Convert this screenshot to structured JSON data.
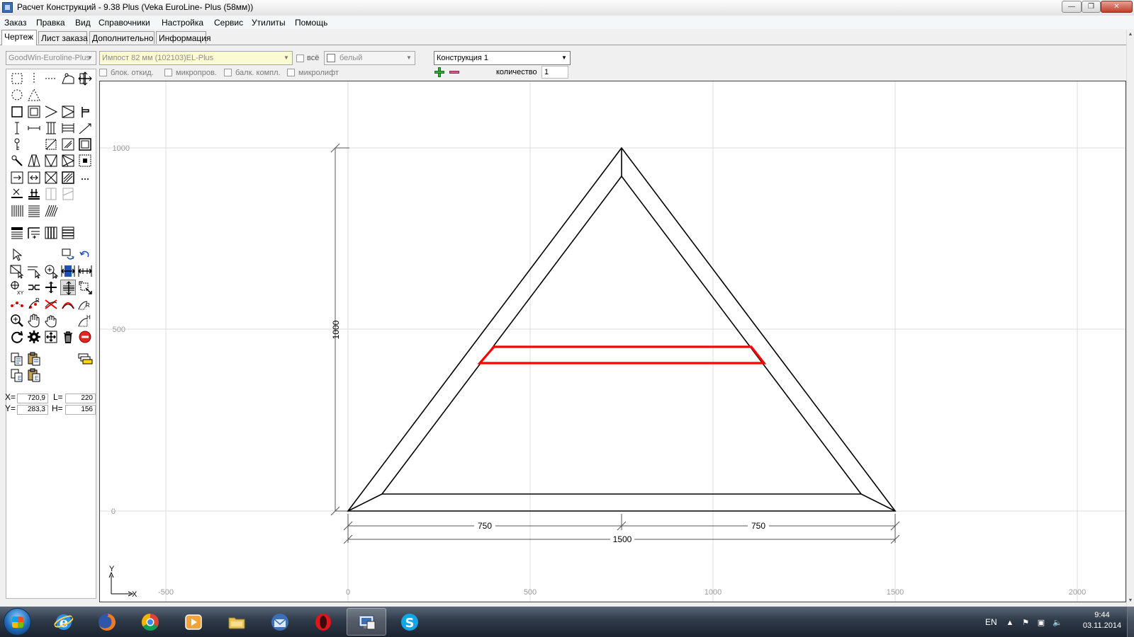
{
  "window": {
    "title": "Расчет Конструкций - 9.38 Plus (Veka EuroLine- Plus (58мм))",
    "min_glyph": "—",
    "max_glyph": "❐",
    "close_glyph": "✕"
  },
  "menu": [
    "Заказ",
    "Правка",
    "Вид",
    "Справочники",
    "Настройка",
    "Сервис",
    "Утилиты",
    "Помощь"
  ],
  "tabs": [
    {
      "label": "Чертеж",
      "active": true
    },
    {
      "label": "Лист заказа",
      "active": false
    },
    {
      "label": "Дополнительно",
      "active": false
    },
    {
      "label": "Информация",
      "active": false
    }
  ],
  "params": {
    "profile_system": "GoodWin-Euroline-Plus",
    "impost": "Импост  82 мм (102103)EL-Plus",
    "all_label": "всё",
    "color": "белый",
    "construction": "Конструкция 1",
    "checkboxes": [
      "блок. откид.",
      "микропров.",
      "балк. компл.",
      "микролифт"
    ],
    "quantity_label": "количество",
    "quantity_value": "1"
  },
  "coords": {
    "x_label": "X=",
    "x_value": "720,9",
    "y_label": "Y=",
    "y_value": "283,3",
    "l_label": "L=",
    "l_value": "220",
    "h_label": "H=",
    "h_value": "156"
  },
  "drawing": {
    "x_ticks": [
      "-500",
      "0",
      "500",
      "1000",
      "1500",
      "2000"
    ],
    "y_ticks": [
      "1000",
      "500",
      "0"
    ],
    "dim_width_left": "750",
    "dim_width_right": "750",
    "dim_width_total": "1500",
    "dim_height": "1000",
    "axis_x_label": "X",
    "axis_y_label": "Y",
    "frame_color": "#000000",
    "impost_color": "#ff0000"
  },
  "taskbar": {
    "apps": [
      "internet-explorer",
      "firefox",
      "chrome",
      "media-player",
      "file-explorer",
      "thunderbird",
      "opera",
      "remote-desktop",
      "skype"
    ],
    "language": "EN",
    "time": "9:44",
    "date": "03.11.2014"
  }
}
